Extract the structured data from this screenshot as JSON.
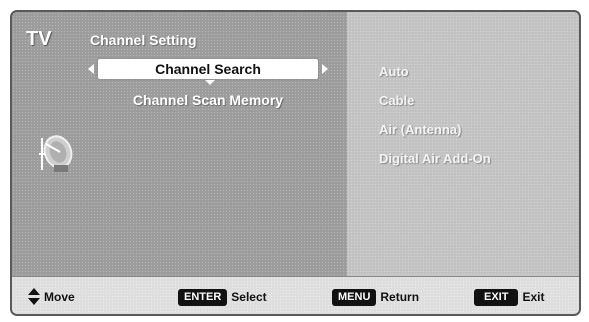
{
  "osd": {
    "source_label": "TV",
    "title": "Channel Setting"
  },
  "menu": {
    "items": [
      {
        "label": "Channel Search",
        "selected": true
      },
      {
        "label": "Channel Scan Memory",
        "selected": false
      }
    ]
  },
  "options": [
    {
      "label": "Auto"
    },
    {
      "label": "Cable"
    },
    {
      "label": "Air (Antenna)"
    },
    {
      "label": "Digital Air Add-On"
    }
  ],
  "icons": {
    "menu_icon": "satellite-dish-icon",
    "move": "up-down-arrows-icon"
  },
  "footer": {
    "move_label": "Move",
    "enter_key": "ENTER",
    "select_label": "Select",
    "menu_key": "MENU",
    "return_label": "Return",
    "exit_key": "EXIT",
    "exit_label": "Exit"
  },
  "colors": {
    "left_pane": "#9c9c9c",
    "right_pane": "#c2c2c2",
    "footer": "#dedede",
    "highlight": "#ffffff",
    "key_bg": "#111111"
  }
}
